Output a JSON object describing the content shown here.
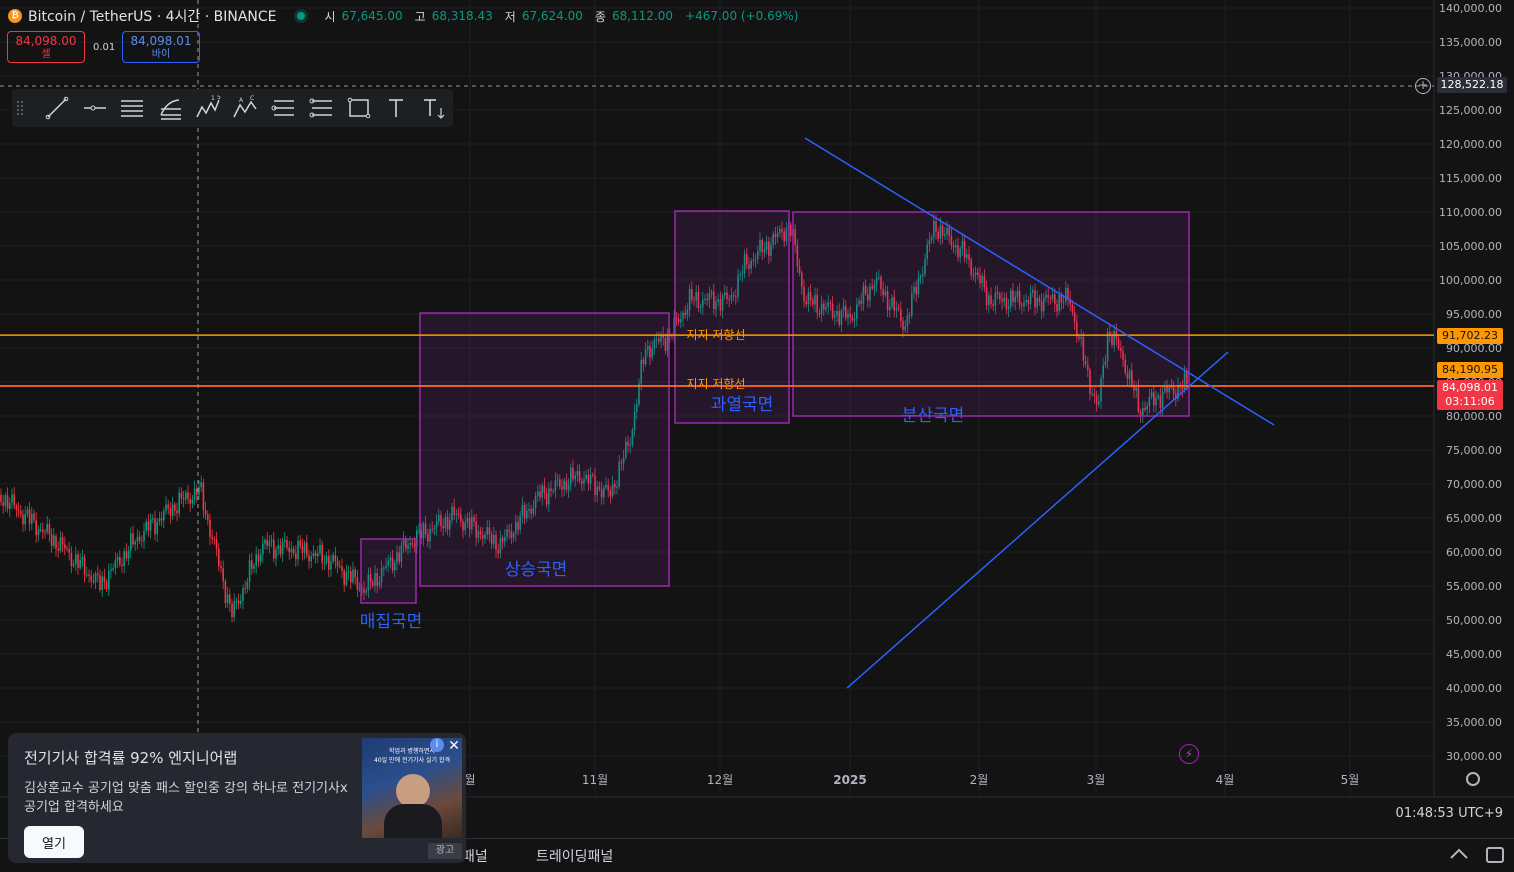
{
  "header": {
    "symbol": "Bitcoin / TetherUS · 4시간 · BINANCE",
    "coin_glyph": "₿",
    "ohlc": [
      {
        "label": "시",
        "value": "67,645.00"
      },
      {
        "label": "고",
        "value": "68,318.43"
      },
      {
        "label": "저",
        "value": "67,624.00"
      },
      {
        "label": "종",
        "value": "68,112.00"
      }
    ],
    "change": "+467.00 (+0.69%)"
  },
  "trade": {
    "sell_price": "84,098.00",
    "sell_label": "셀",
    "spread": "0.01",
    "buy_price": "84,098.01",
    "buy_label": "바이"
  },
  "toolbar": {
    "tools": [
      "trendline-icon",
      "horizontal-ray-icon",
      "parallel-channel-icon",
      "fib-icon",
      "elliott-wave-icon",
      "abc-pattern-icon",
      "long-position-icon",
      "short-position-icon",
      "rectangle-icon",
      "text-icon",
      "text-size-icon"
    ]
  },
  "price_axis": {
    "labels": [
      "140,000.00",
      "135,000.00",
      "130,000.00",
      "125,000.00",
      "120,000.00",
      "115,000.00",
      "110,000.00",
      "105,000.00",
      "100,000.00",
      "95,000.00",
      "90,000.00",
      "85,000.00",
      "80,000.00",
      "75,000.00",
      "70,000.00",
      "65,000.00",
      "60,000.00",
      "55,000.00",
      "50,000.00",
      "45,000.00",
      "40,000.00",
      "35,000.00",
      "30,000.00"
    ],
    "crosshair_price": "128,522.18",
    "resistance_price": "91,702.23",
    "support_price": "84,190.95",
    "last_price": "84,098.01",
    "countdown": "03:11:06"
  },
  "time_axis": {
    "labels": [
      "월",
      "11월",
      "12월",
      "2025",
      "2월",
      "3월",
      "4월",
      "5월"
    ]
  },
  "annotations": {
    "zone_accumulation": "매집국면",
    "zone_uptrend": "상승국면",
    "zone_overheat": "과열국면",
    "zone_distribution": "분산국면",
    "line_label_upper": "지지 저항선",
    "line_label_lower": "지지 저항선"
  },
  "colors": {
    "background": "#131313",
    "up": "#089981",
    "down": "#f23645",
    "level_line": "#ff9800",
    "zone_border": "#9c27b0",
    "zone_fill": "rgba(156,39,176,0.14)",
    "trendline": "#2962ff",
    "zone_text": "#2962ff"
  },
  "status": {
    "clock": "01:48:53 UTC+9"
  },
  "bottom_tabs": [
    "패널",
    "트레이딩패널"
  ],
  "ad": {
    "title": "전기기사 합격률 92% 엔지니어랩",
    "text": "김상훈교수 공기업 맞춤 패스 할인중 강의 하나로 전기기사x공기업 합격하세요",
    "open_button": "열기",
    "badge": "광고",
    "image_caption_1": "학업과 병행하면서",
    "image_caption_2": "40일 만에 전기기사 실기 합격",
    "close_glyph": "✕",
    "info_glyph": "i"
  }
}
